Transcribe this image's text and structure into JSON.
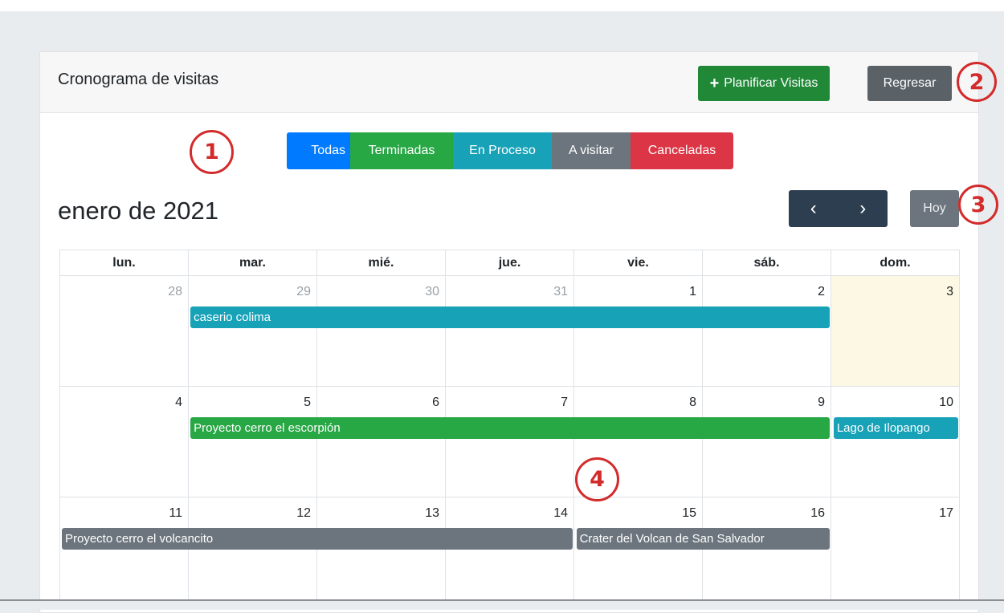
{
  "header": {
    "title": "Cronograma de visitas",
    "plan_label": "Planificar Visitas",
    "plan_icon": "plus-icon",
    "back_label": "Regresar"
  },
  "filters": [
    {
      "label": "Todas",
      "color": "#007bff"
    },
    {
      "label": "Terminadas",
      "color": "#28a745"
    },
    {
      "label": "En Proceso",
      "color": "#17a2b8"
    },
    {
      "label": "A visitar",
      "color": "#6c757d"
    },
    {
      "label": "Canceladas",
      "color": "#dc3545"
    }
  ],
  "calendar": {
    "month_title": "enero de 2021",
    "prev_icon": "chevron-left-icon",
    "next_icon": "chevron-right-icon",
    "prev_glyph": "‹",
    "next_glyph": "›",
    "today_label": "Hoy",
    "weekdays": [
      "lun.",
      "mar.",
      "mié.",
      "jue.",
      "vie.",
      "sáb.",
      "dom."
    ],
    "weeks": [
      {
        "days": [
          {
            "num": "28",
            "other": true
          },
          {
            "num": "29",
            "other": true
          },
          {
            "num": "30",
            "other": true
          },
          {
            "num": "31",
            "other": true
          },
          {
            "num": "1",
            "other": false
          },
          {
            "num": "2",
            "other": false
          },
          {
            "num": "3",
            "other": false,
            "today": true
          }
        ],
        "events": [
          {
            "title": "caserio colima",
            "start": 1,
            "end": 5,
            "color": "#17a2b8"
          }
        ]
      },
      {
        "days": [
          {
            "num": "4",
            "other": false
          },
          {
            "num": "5",
            "other": false
          },
          {
            "num": "6",
            "other": false
          },
          {
            "num": "7",
            "other": false
          },
          {
            "num": "8",
            "other": false
          },
          {
            "num": "9",
            "other": false
          },
          {
            "num": "10",
            "other": false
          }
        ],
        "events": [
          {
            "title": "Proyecto cerro el escorpión",
            "start": 1,
            "end": 5,
            "color": "#28a745"
          },
          {
            "title": "Lago de Ilopango",
            "start": 6,
            "end": 6,
            "color": "#17a2b8"
          }
        ]
      },
      {
        "days": [
          {
            "num": "11",
            "other": false
          },
          {
            "num": "12",
            "other": false
          },
          {
            "num": "13",
            "other": false
          },
          {
            "num": "14",
            "other": false
          },
          {
            "num": "15",
            "other": false
          },
          {
            "num": "16",
            "other": false
          },
          {
            "num": "17",
            "other": false
          }
        ],
        "events": [
          {
            "title": "Proyecto cerro el volcancito",
            "start": 0,
            "end": 3,
            "color": "#6c757d"
          },
          {
            "title": "Crater del Volcan de San Salvador",
            "start": 4,
            "end": 5,
            "color": "#6c757d"
          }
        ]
      }
    ]
  },
  "markers": [
    "1",
    "2",
    "3",
    "4"
  ]
}
